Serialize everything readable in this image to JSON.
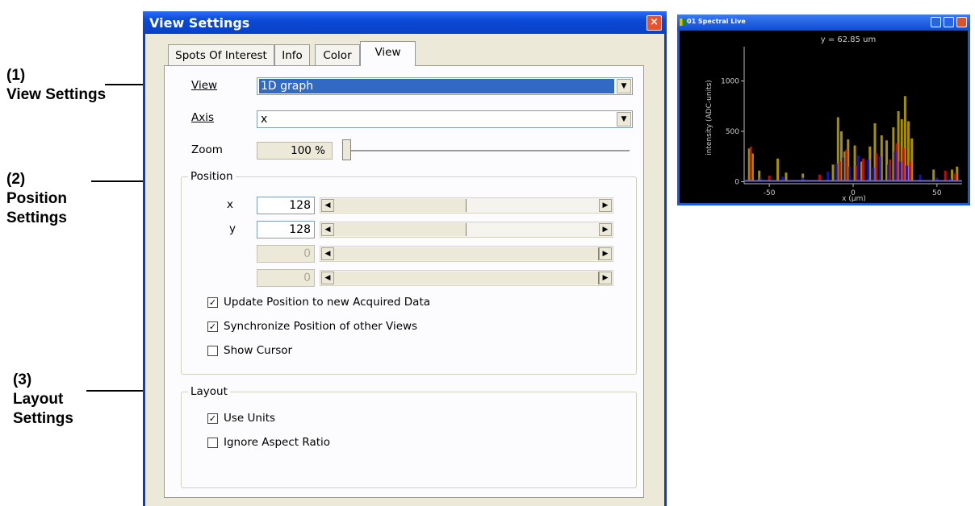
{
  "annotations": [
    {
      "num": "(1)",
      "line1": "View Settings",
      "line2": ""
    },
    {
      "num": "(2)",
      "line1": "Position",
      "line2": "Settings"
    },
    {
      "num": "(3)",
      "line1": "Layout",
      "line2": "Settings"
    }
  ],
  "dialog": {
    "title": "View Settings",
    "close_symbol": "×",
    "tabs": [
      "Spots Of Interest",
      "Info",
      "Color",
      "View"
    ],
    "active_tab": "View",
    "view_label": "View",
    "view_value": "1D graph",
    "axis_label": "Axis",
    "axis_value": "x",
    "zoom_label": "Zoom",
    "zoom_value": "100 %",
    "position": {
      "title": "Position",
      "rows": [
        {
          "label": "x",
          "value": "128",
          "level": 0.5
        },
        {
          "label": "y",
          "value": "128",
          "level": 0.5
        },
        {
          "label": "",
          "value": "0",
          "level": 1.0
        },
        {
          "label": "",
          "value": "0",
          "level": 1.0
        }
      ],
      "checkboxes": [
        {
          "label": "Update Position to new Acquired Data",
          "checked": true
        },
        {
          "label": "Synchronize Position of other Views",
          "checked": true
        },
        {
          "label": "Show Cursor",
          "checked": false
        }
      ]
    },
    "layout": {
      "title": "Layout",
      "checkboxes": [
        {
          "label": "Use Units",
          "checked": true
        },
        {
          "label": "Ignore Aspect Ratio",
          "checked": false
        }
      ]
    }
  },
  "spectral": {
    "title": "01 Spectral Live",
    "y_readout": "y = 62.85 um",
    "chart_data": {
      "type": "bar",
      "xlabel": "x (μm)",
      "ylabel": "intensity (ADC-units)",
      "xlim": [
        -65,
        65
      ],
      "ylim": [
        -20,
        1300
      ],
      "x_ticks": [
        "-50",
        "0",
        "50"
      ],
      "y_ticks": [
        "0",
        "500",
        "1000"
      ],
      "series": [
        {
          "color": "#b8a000",
          "x": [
            -62,
            -60,
            -56,
            -45,
            -40,
            -30,
            -12,
            -9,
            -7,
            -5,
            -3,
            1,
            5,
            10,
            13,
            17,
            20,
            24,
            27,
            29,
            31,
            33,
            35,
            48,
            59,
            62
          ],
          "values": [
            330,
            280,
            110,
            230,
            90,
            80,
            170,
            640,
            500,
            300,
            420,
            360,
            200,
            350,
            580,
            460,
            410,
            540,
            700,
            620,
            850,
            600,
            430,
            120,
            120,
            150
          ]
        },
        {
          "color": "#cc1010",
          "x": [
            -61,
            -50,
            -20,
            -8,
            -4,
            2,
            6,
            14,
            22,
            26,
            30,
            34,
            55,
            61
          ],
          "values": [
            350,
            60,
            70,
            200,
            320,
            160,
            230,
            280,
            220,
            380,
            330,
            200,
            110,
            80
          ]
        },
        {
          "color": "#1515d0",
          "x": [
            -55,
            -42,
            -30,
            -15,
            -10,
            -6,
            -2,
            3,
            9,
            12,
            16,
            21,
            25,
            28,
            32,
            40,
            50,
            58
          ],
          "values": [
            40,
            50,
            40,
            100,
            180,
            240,
            150,
            260,
            220,
            140,
            250,
            170,
            300,
            200,
            160,
            70,
            40,
            30
          ]
        }
      ]
    }
  }
}
